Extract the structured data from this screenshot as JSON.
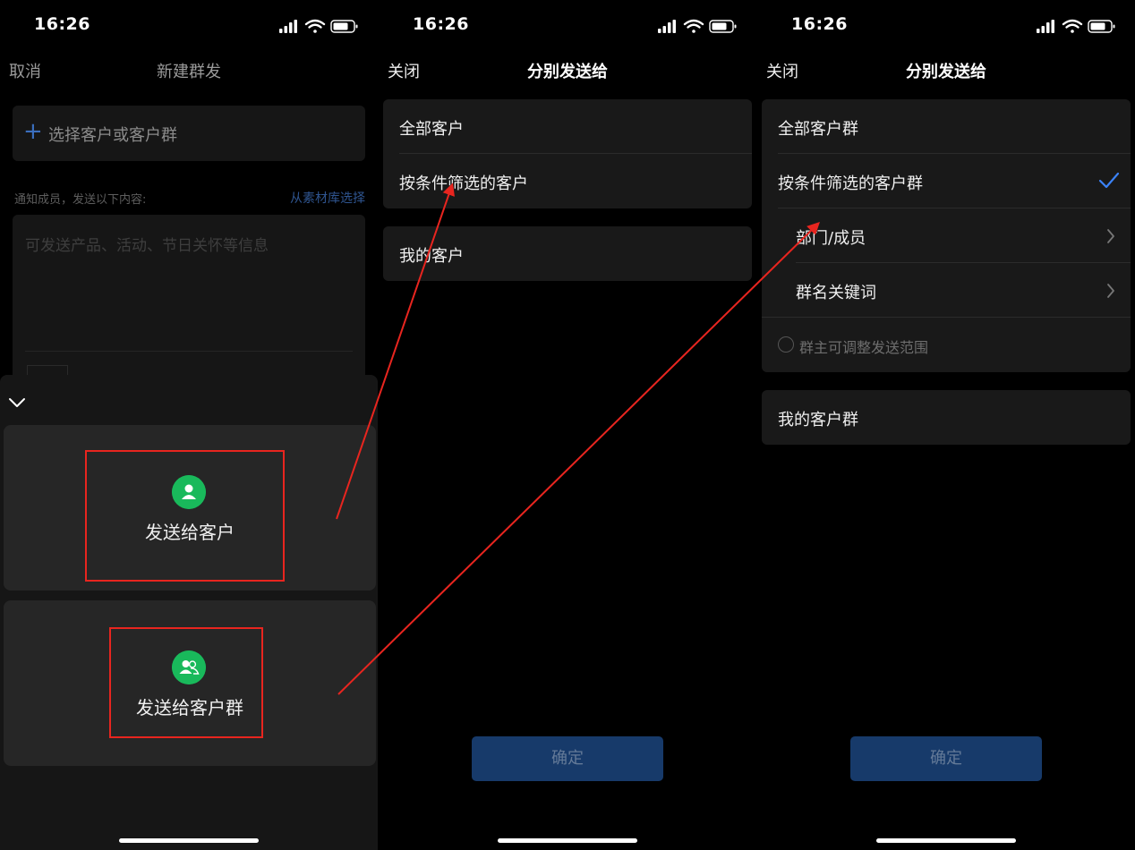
{
  "status_time": "16:26",
  "screen1": {
    "cancel": "取消",
    "title": "新建群发",
    "select_target": "选择客户或客户群",
    "notice_label": "通知成员，发送以下内容:",
    "from_library": "从素材库选择",
    "content_placeholder": "可发送产品、活动、节日关怀等信息",
    "send_to_customer": "发送给客户",
    "send_to_group": "发送给客户群"
  },
  "screen2": {
    "close": "关闭",
    "title": "分别发送给",
    "options": [
      "全部客户",
      "按条件筛选的客户"
    ],
    "my_customers": "我的客户",
    "confirm": "确定"
  },
  "screen3": {
    "close": "关闭",
    "title": "分别发送给",
    "all_groups": "全部客户群",
    "filtered_groups": "按条件筛选的客户群",
    "dept_member": "部门/成员",
    "group_keyword": "群名关键词",
    "owner_adjust": "群主可调整发送范围",
    "my_groups": "我的客户群",
    "confirm": "确定"
  },
  "colors": {
    "accent_blue": "#3b82f6",
    "green_icon": "#19b95b",
    "annotation_red": "#e8251f",
    "confirm_bg": "#173a6a"
  },
  "icons": [
    "signal-icon",
    "wifi-icon",
    "battery-icon",
    "plus-icon",
    "chevron-down-icon",
    "person-icon",
    "people-icon",
    "chevron-right-icon",
    "checkmark-icon",
    "radio-icon"
  ]
}
